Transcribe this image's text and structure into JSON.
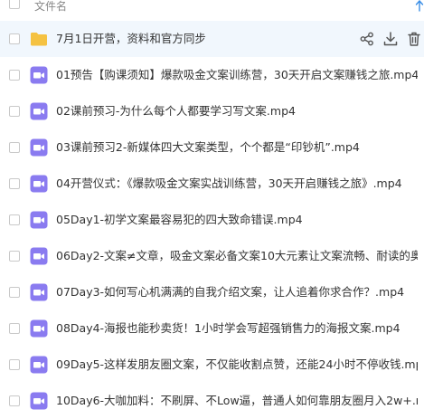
{
  "header": {
    "column_title": "文件名"
  },
  "files": [
    {
      "name": "7月1日开营，资料和官方同步",
      "type": "folder"
    },
    {
      "name": "01预告【购课须知】爆款吸金文案训练营，30天开启文案赚钱之旅.mp4",
      "type": "video"
    },
    {
      "name": "02课前预习-为什么每个人都要学习写文案.mp4",
      "type": "video"
    },
    {
      "name": "03课前预习2-新媒体四大文案类型，个个都是“印钞机”.mp4",
      "type": "video"
    },
    {
      "name": "04开营仪式：《爆款吸金文案实战训练营，30天开启赚钱之旅》.mp4",
      "type": "video"
    },
    {
      "name": "05Day1-初学文案最容易犯的四大致命错误.mp4",
      "type": "video"
    },
    {
      "name": "06Day2-文案≠文章，吸金文案必备文案10大元素让文案流畅、耐读的奥...",
      "type": "video"
    },
    {
      "name": "07Day3-如何写心机满满的自我介绍文案，让人追着你求合作？.mp4",
      "type": "video"
    },
    {
      "name": "08Day4-海报也能秒卖货！1小时学会写超强销售力的海报文案.mp4",
      "type": "video"
    },
    {
      "name": "09Day5-这样发朋友圈文案，不仅能收割点赞，还能24小时不停收钱.mp4",
      "type": "video"
    },
    {
      "name": "10Day6-大咖加料：不刷屏、不Low逼，普通人如何靠朋友圈月入2w+.mp4",
      "type": "video"
    }
  ],
  "colors": {
    "folder": "#f5c242",
    "video": "#8a7bf0",
    "accent": "#3a8ee6",
    "selected_row": "#f1f7fd"
  }
}
